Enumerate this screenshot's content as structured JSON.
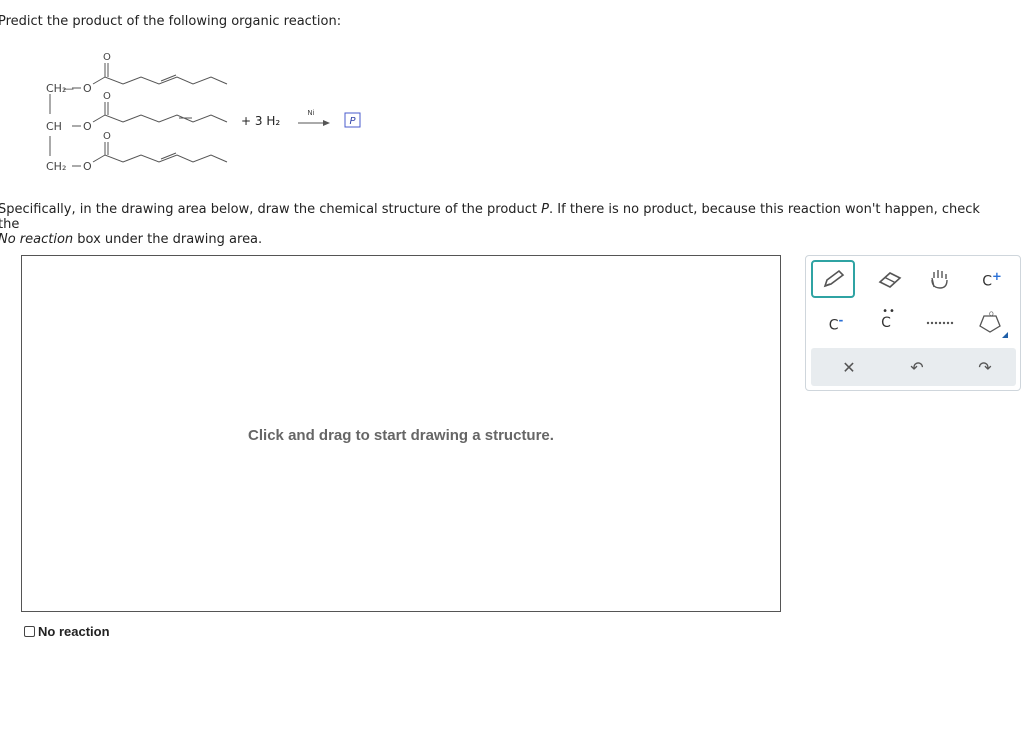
{
  "question": "Predict the product of the following organic reaction:",
  "reaction": {
    "groups": [
      "CH₂",
      "CH",
      "CH₂"
    ],
    "ester_oxygen": "O",
    "carbonyl_oxygen": "O",
    "reagent": "+ 3 H₂",
    "catalyst": "Ni",
    "product_label": "P"
  },
  "instructions": {
    "part1": "Specifically, in the drawing area below, draw the chemical structure of the product ",
    "product": "P",
    "part2": ". If there is no product, because this reaction won't happen, check the",
    "no_reaction_ref": "No reaction",
    "part3": " box under the drawing area."
  },
  "canvas": {
    "hint": "Click and drag to start drawing a structure."
  },
  "no_reaction": {
    "label": "No reaction",
    "checked": false
  },
  "toolbar": {
    "tools": [
      {
        "name": "pencil-icon",
        "selected": true
      },
      {
        "name": "eraser-icon"
      },
      {
        "name": "hand-icon"
      },
      {
        "name": "carbocation-icon",
        "label": "C",
        "sup": "+"
      },
      {
        "name": "carbanion-icon",
        "label": "C",
        "sup": "-"
      },
      {
        "name": "lone-pair-icon",
        "label": "C"
      },
      {
        "name": "dots-icon"
      },
      {
        "name": "ring-template-icon"
      },
      {
        "name": "clear-icon"
      },
      {
        "name": "undo-icon"
      },
      {
        "name": "redo-icon"
      }
    ],
    "accent": "#2fa3a3"
  }
}
